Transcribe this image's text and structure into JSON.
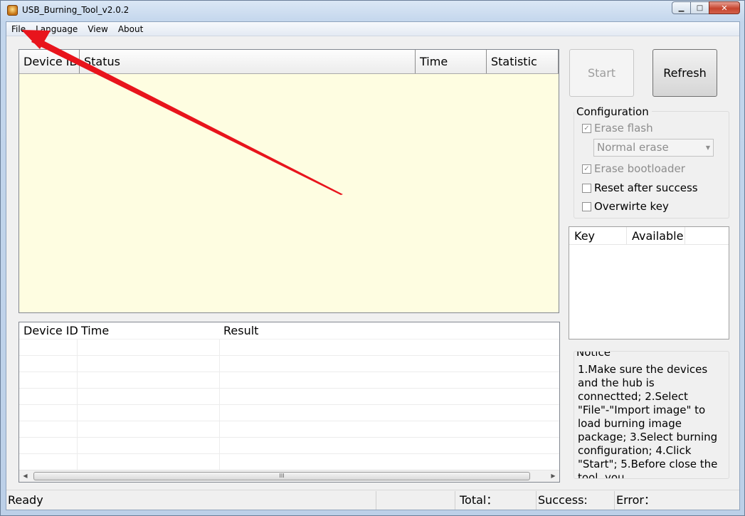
{
  "window": {
    "title": "USB_Burning_Tool_v2.0.2",
    "minimize_glyph": "▁",
    "maximize_glyph": "□",
    "close_glyph": "✕"
  },
  "menu": {
    "file": "File",
    "language": "Language",
    "view": "View",
    "about": "About"
  },
  "device_list": {
    "columns": [
      "Device ID",
      "Status",
      "Time",
      "Statistic"
    ],
    "background": "#fefde1"
  },
  "result_list": {
    "columns": [
      "Device ID",
      "Time",
      "Result"
    ],
    "scroll_thumb_glyph": "III",
    "left_arrow": "◀",
    "right_arrow": "▶"
  },
  "buttons": {
    "start": "Start",
    "refresh": "Refresh"
  },
  "configuration": {
    "title": "Configuration",
    "erase_flash": "Erase flash",
    "erase_mode": "Normal erase",
    "erase_bootloader": "Erase bootloader",
    "reset_after_success": "Reset after success",
    "overwrite_key": "Overwirte key",
    "check_glyph": "✓"
  },
  "key_list": {
    "columns": [
      "Key",
      "Available"
    ]
  },
  "notice": {
    "title": "Notice",
    "text": "1.Make sure the devices and the hub is connectted; 2.Select \"File\"-\"Import image\" to load burning image package; 3.Select burning configuration; 4.Click \"Start\"; 5.Before close the tool, you"
  },
  "status_bar": {
    "state": "Ready",
    "total": "Total：",
    "success": "Success:",
    "error": "Error："
  },
  "colors": {
    "annotation_arrow": "#e8141c"
  }
}
